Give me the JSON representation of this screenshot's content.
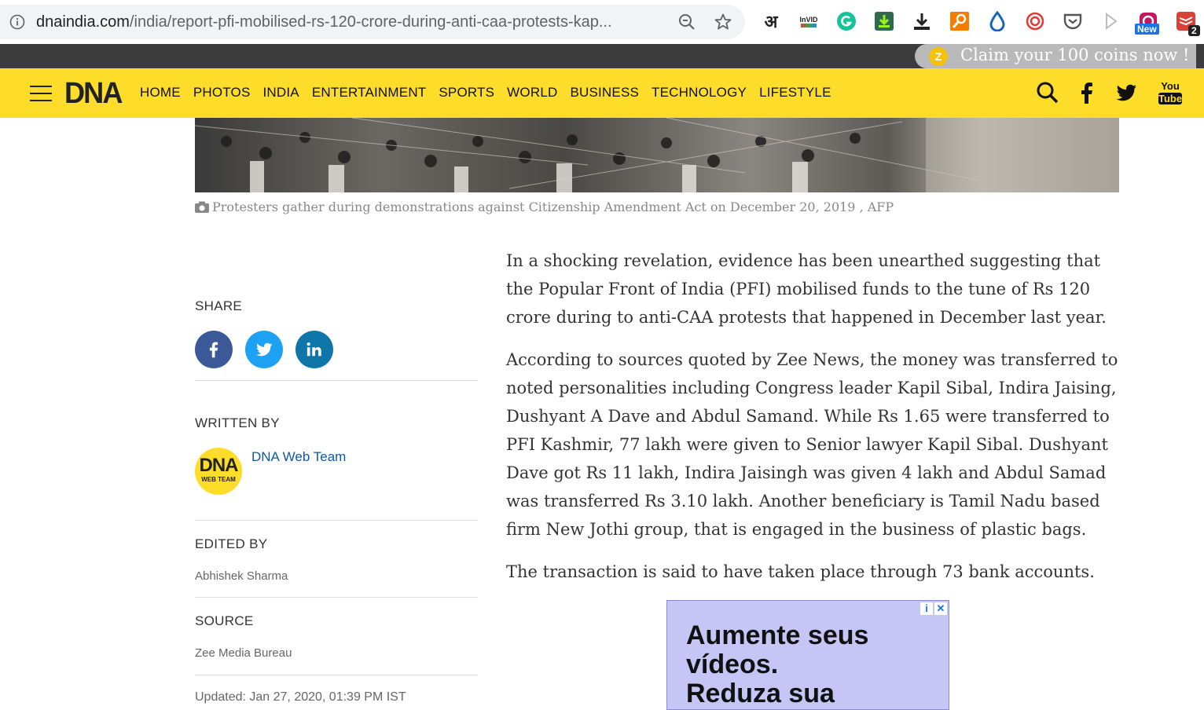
{
  "browser": {
    "url_host": "dnaindia.com",
    "url_path": "/india/report-pfi-mobilised-rs-120-crore-during-anti-caa-protests-kap...",
    "ext_labels": {
      "invid": "InVID",
      "new_badge": "New",
      "count_badge": "2",
      "hindi": "अ"
    }
  },
  "coinbar": {
    "text": "Claim your 100 coins now !",
    "coin_symbol": "Z"
  },
  "navbar": {
    "logo": "DNA",
    "links": [
      "HOME",
      "PHOTOS",
      "INDIA",
      "ENTERTAINMENT",
      "SPORTS",
      "WORLD",
      "BUSINESS",
      "TECHNOLOGY",
      "LIFESTYLE"
    ],
    "youtube_label_1": "You",
    "youtube_label_2": "Tube"
  },
  "hero": {
    "caption": "Protesters gather during demonstrations against Citizenship Amendment Act on December 20, 2019 , AFP"
  },
  "sidebar": {
    "share_label": "SHARE",
    "written_by_label": "WRITTEN BY",
    "author_name": "DNA Web Team",
    "avatar_line1": "DNA",
    "avatar_line2": "WEB TEAM",
    "edited_by_label": "EDITED BY",
    "editor_name": "Abhishek Sharma",
    "source_label": "SOURCE",
    "source_name": "Zee Media Bureau",
    "updated": "Updated: Jan 27, 2020, 01:39 PM IST"
  },
  "article": {
    "paragraphs": [
      "In a shocking revelation, evidence has been unearthed suggesting that the Popular Front of India (PFI) mobilised funds to the tune of Rs 120 crore during to anti-CAA protests that happened in December last year.",
      "According to sources quoted by Zee News, the money was transferred to noted personalities including Congress leader Kapil Sibal, Indira Jaising, Dushyant A Dave and Abdul Samand. While Rs 1.65 were transferred to PFI Kashmir, 77 lakh were given to Senior lawyer Kapil Sibal. Dushyant Dave got Rs 11 lakh, Indira Jaisingh was given 4 lakh and Abdul Samad was transferred Rs 3.10 lakh. Another beneficiary is Tamil Nadu based firm New Jothi group, that is engaged in the business of plastic bags.",
      "The transaction is said to have taken place through 73 bank accounts."
    ]
  },
  "ad": {
    "line1": "Aumente seus",
    "line2": "vídeos.",
    "line3": "Reduza sua",
    "info_icon": "i",
    "close_icon": "✕"
  },
  "colors": {
    "accent": "#fddc2a",
    "facebook": "#3b5998",
    "twitter": "#1da1f2",
    "linkedin": "#0e76a8",
    "link": "#0d5aa7"
  }
}
